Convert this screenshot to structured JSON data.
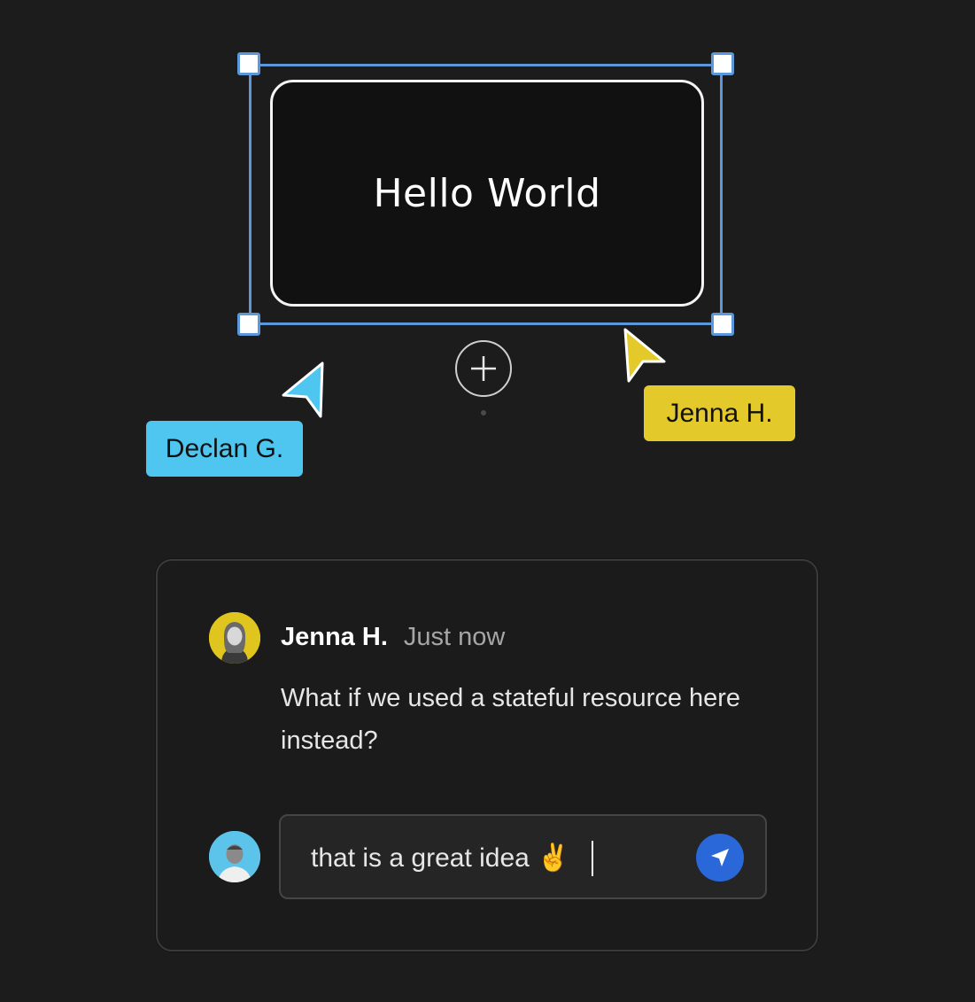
{
  "canvas": {
    "shape_text": "Hello World",
    "add_button_symbol": "+",
    "accent_color": "#5b97d9",
    "cursors": [
      {
        "name": "Declan G.",
        "color": "#4ec6ef"
      },
      {
        "name": "Jenna H.",
        "color": "#e3c92a"
      }
    ]
  },
  "comment": {
    "author": "Jenna H.",
    "timestamp": "Just now",
    "body": "What if we used a stateful resource here instead?",
    "author_avatar_icon": "user-avatar-jenna",
    "reply": {
      "value": "that is a great idea ✌️",
      "avatar_icon": "user-avatar-current",
      "send_icon": "send-arrow-icon",
      "send_color": "#2a67d8"
    }
  }
}
